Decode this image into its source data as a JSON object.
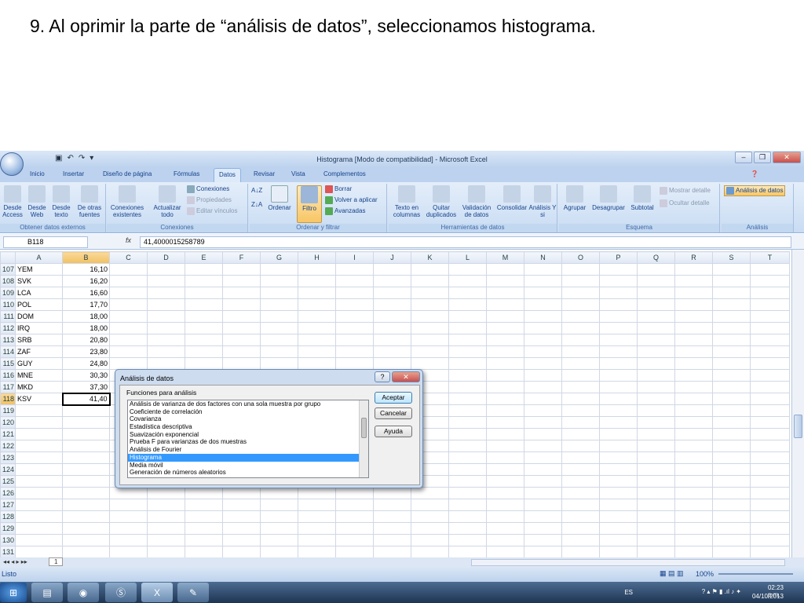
{
  "slide": {
    "title": "9. Al oprimir la parte de “análisis de datos”, seleccionamos histograma."
  },
  "excel": {
    "window_title": "Histograma  [Modo de compatibilidad] - Microsoft Excel",
    "office_button": "Office",
    "tabs": [
      "Inicio",
      "Insertar",
      "Diseño de página",
      "Fórmulas",
      "Datos",
      "Revisar",
      "Vista",
      "Complementos"
    ],
    "active_tab": "Datos",
    "ribbon": {
      "groups": [
        {
          "label": "Obtener datos externos",
          "buttons": [
            "Desde Access",
            "Desde Web",
            "Desde texto",
            "De otras fuentes"
          ]
        },
        {
          "label": "Conexiones",
          "buttons": [
            "Conexiones existentes",
            "Actualizar todo",
            "Conexiones",
            "Propiedades",
            "Editar vínculos"
          ]
        },
        {
          "label": "Ordenar y filtrar",
          "buttons": [
            "Ordenar",
            "Filtro",
            "Borrar",
            "Volver a aplicar",
            "Avanzadas"
          ]
        },
        {
          "label": "Herramientas de datos",
          "buttons": [
            "Texto en columnas",
            "Quitar duplicados",
            "Validación de datos",
            "Consolidar",
            "Análisis Y si"
          ]
        },
        {
          "label": "Esquema",
          "buttons": [
            "Agrupar",
            "Desagrupar",
            "Subtotal",
            "Mostrar detalle",
            "Ocultar detalle"
          ]
        },
        {
          "label": "Análisis",
          "buttons": [
            "Análisis de datos"
          ]
        }
      ]
    },
    "name_box": "B118",
    "fx_label": "fx",
    "formula": "41,4000015258789",
    "columns": [
      "A",
      "B",
      "C",
      "D",
      "E",
      "F",
      "G",
      "H",
      "I",
      "J",
      "K",
      "L",
      "M",
      "N",
      "O",
      "P",
      "Q",
      "R",
      "S",
      "T"
    ],
    "rows": [
      {
        "num": "107",
        "a": "YEM",
        "b": "16,10"
      },
      {
        "num": "108",
        "a": "SVK",
        "b": "16,20"
      },
      {
        "num": "109",
        "a": "LCA",
        "b": "16,60"
      },
      {
        "num": "110",
        "a": "POL",
        "b": "17,70"
      },
      {
        "num": "111",
        "a": "DOM",
        "b": "18,00"
      },
      {
        "num": "112",
        "a": "IRQ",
        "b": "18,00"
      },
      {
        "num": "113",
        "a": "SRB",
        "b": "20,80"
      },
      {
        "num": "114",
        "a": "ZAF",
        "b": "23,80"
      },
      {
        "num": "115",
        "a": "GUY",
        "b": "24,80"
      },
      {
        "num": "116",
        "a": "MNE",
        "b": "30,30"
      },
      {
        "num": "117",
        "a": "MKD",
        "b": "37,30"
      },
      {
        "num": "118",
        "a": "KSV",
        "b": "41,40"
      },
      {
        "num": "119",
        "a": "",
        "b": ""
      },
      {
        "num": "120",
        "a": "",
        "b": ""
      },
      {
        "num": "121",
        "a": "",
        "b": ""
      },
      {
        "num": "122",
        "a": "",
        "b": ""
      },
      {
        "num": "123",
        "a": "",
        "b": ""
      },
      {
        "num": "124",
        "a": "",
        "b": ""
      },
      {
        "num": "125",
        "a": "",
        "b": ""
      },
      {
        "num": "126",
        "a": "",
        "b": ""
      },
      {
        "num": "127",
        "a": "",
        "b": ""
      },
      {
        "num": "128",
        "a": "",
        "b": ""
      },
      {
        "num": "129",
        "a": "",
        "b": ""
      },
      {
        "num": "130",
        "a": "",
        "b": ""
      },
      {
        "num": "131",
        "a": "",
        "b": ""
      }
    ],
    "sheet_tab": "1",
    "status": "Listo",
    "zoom": "100%"
  },
  "dialog": {
    "title": "Análisis de datos",
    "list_label": "Funciones para análisis",
    "items": [
      "Análisis de varianza de dos factores con una sola muestra por grupo",
      "Coeficiente de correlación",
      "Covarianza",
      "Estadística descriptiva",
      "Suavización exponencial",
      "Prueba F para varianzas de dos muestras",
      "Análisis de Fourier",
      "Histograma",
      "Media móvil",
      "Generación de números aleatorios"
    ],
    "selected": "Histograma",
    "buttons": {
      "ok": "Aceptar",
      "cancel": "Cancelar",
      "help": "Ayuda"
    },
    "help_glyph": "?",
    "close_glyph": "✕"
  },
  "taskbar": {
    "language": "ES",
    "time": "02:23 p.m.",
    "date": "04/10/2013"
  }
}
